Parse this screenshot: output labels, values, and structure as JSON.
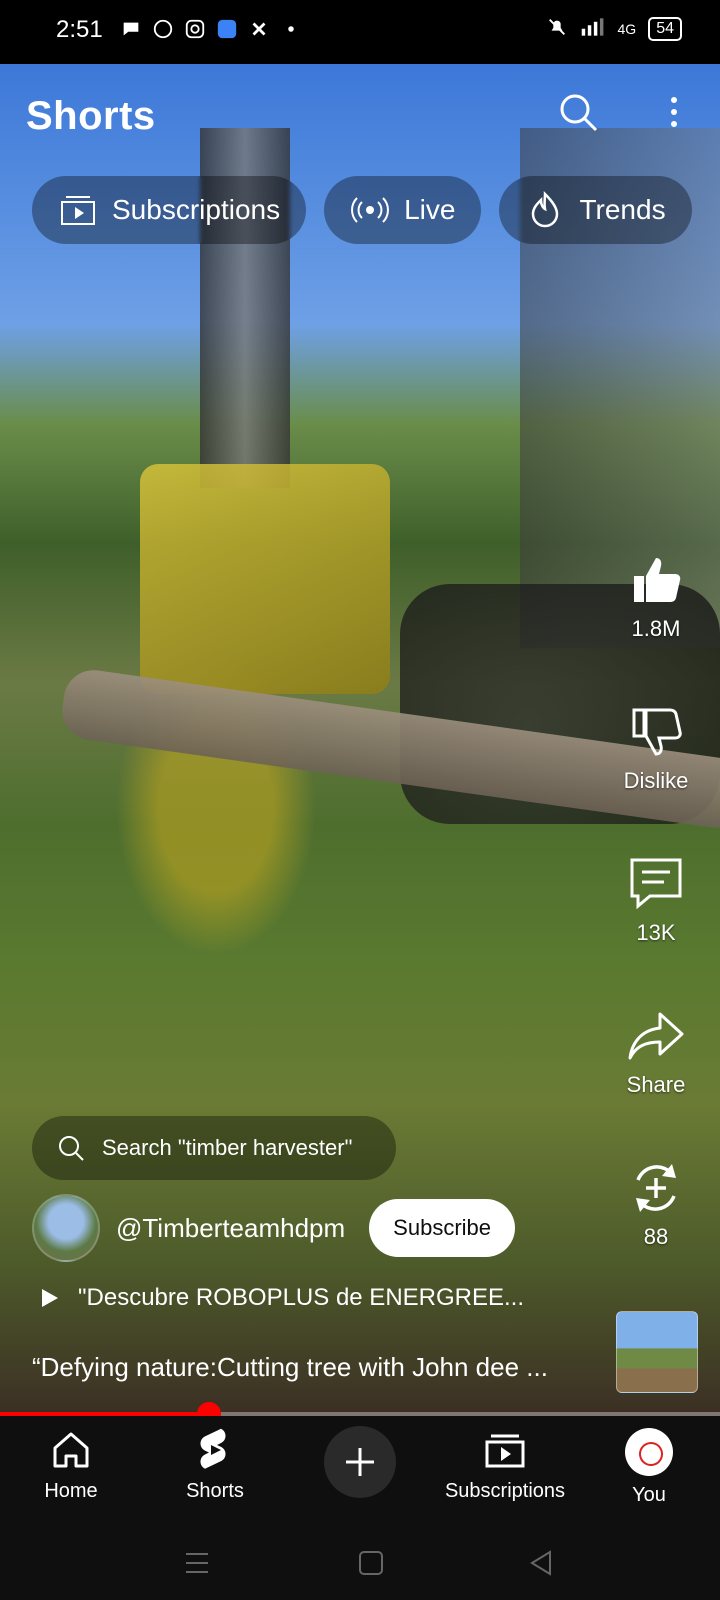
{
  "status": {
    "time": "2:51",
    "signal_tag": "4G",
    "battery": "54"
  },
  "header": {
    "title": "Shorts"
  },
  "chips": [
    {
      "label": "Subscriptions",
      "icon": "subscriptions-icon"
    },
    {
      "label": "Live",
      "icon": "live-icon"
    },
    {
      "label": "Trends",
      "icon": "trends-icon"
    }
  ],
  "actions": {
    "like": "1.8M",
    "dislike": "Dislike",
    "comments": "13K",
    "share": "Share",
    "remix": "88"
  },
  "search_suggestion": "Search \"timber harvester\"",
  "channel": {
    "handle": "@Timberteamhdpm",
    "subscribe_label": "Subscribe"
  },
  "music": {
    "title": "\"Descubre ROBOPLUS de ENERGREE..."
  },
  "caption": "“Defying nature:Cutting tree with John dee ...",
  "progress": {
    "fraction": 0.29
  },
  "bottom_nav": [
    {
      "label": "Home"
    },
    {
      "label": "Shorts"
    },
    {
      "label": "Subscriptions"
    },
    {
      "label": "You"
    }
  ],
  "colors": {
    "accent": "#ff0000",
    "nav_bg": "#0f0f0f"
  }
}
